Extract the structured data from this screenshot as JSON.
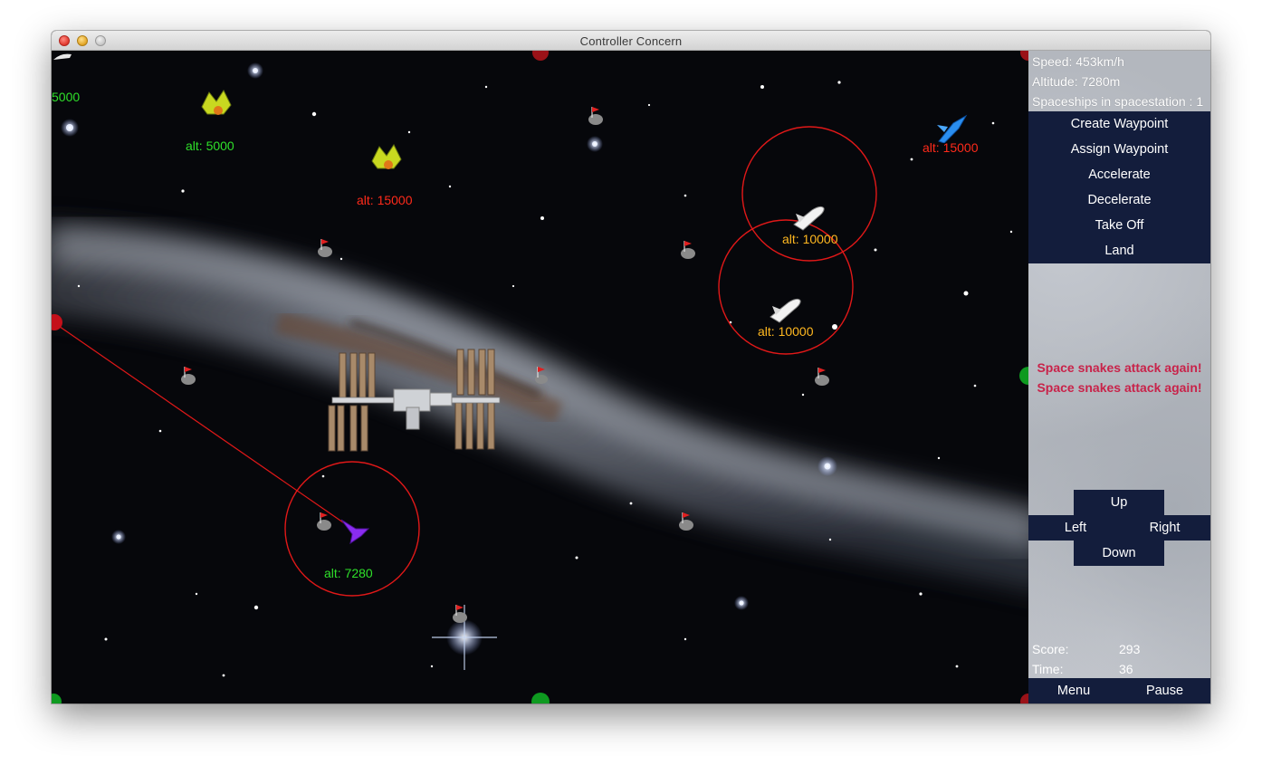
{
  "window": {
    "title": "Controller Concern"
  },
  "hud": {
    "speed_text": "Speed: 453km/h",
    "altitude_text": "Altitude: 7280m",
    "spaceships_text": "Spaceships in spacestation : 1"
  },
  "commands": [
    "Create Waypoint",
    "Assign Waypoint",
    "Accelerate",
    "Decelerate",
    "Take Off",
    "Land"
  ],
  "messages": [
    "Space snakes attack again!",
    "Space snakes attack again!"
  ],
  "dpad": {
    "up": "Up",
    "left": "Left",
    "right": "Right",
    "down": "Down"
  },
  "score": {
    "score_label": "Score:",
    "score_value": "293",
    "time_label": "Time:",
    "time_value": "36"
  },
  "footer": {
    "menu": "Menu",
    "pause": "Pause"
  },
  "ships": [
    {
      "label": "alt: 5000",
      "color": "green",
      "kind": "alien-ship"
    },
    {
      "label": "alt: 15000",
      "color": "red",
      "kind": "alien-ship"
    },
    {
      "label": "alt: 10000",
      "color": "yellow",
      "kind": "shuttle"
    },
    {
      "label": "alt: 10000",
      "color": "yellow",
      "kind": "shuttle"
    },
    {
      "label": "alt: 15000",
      "color": "red",
      "kind": "blue-jet"
    },
    {
      "label": "alt: 7280",
      "color": "green",
      "kind": "purple-ship"
    }
  ],
  "offscreen_ship_label": "5000",
  "colors": {
    "panel_navy": "#131d3c",
    "message_red": "#c8234a",
    "alt_green": "#2fe02a",
    "alt_red": "#ff2a1a",
    "alt_yellow": "#ffb820",
    "ring_red": "#e01818"
  }
}
